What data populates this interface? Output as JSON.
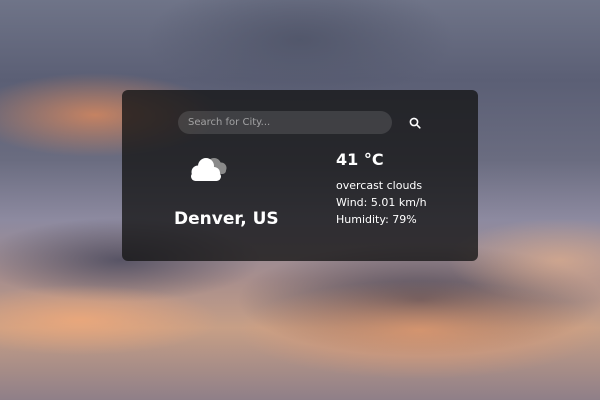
{
  "search": {
    "placeholder": "Search for City...",
    "value": ""
  },
  "weather": {
    "city": "Denver, US",
    "temperature": "41 °C",
    "description": "overcast clouds",
    "wind": "Wind: 5.01 km/h",
    "humidity": "Humidity: 79%",
    "icon": "overcast-clouds-icon"
  },
  "colors": {
    "card_background": "#141414",
    "text": "#ffffff"
  }
}
